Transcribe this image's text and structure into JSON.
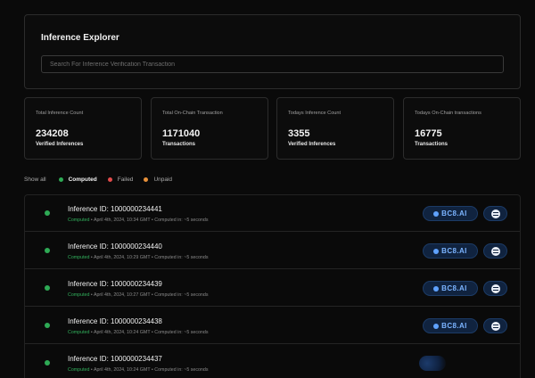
{
  "explorer": {
    "title": "Inference Explorer",
    "search_placeholder": "Search For Inference Verification Transaction"
  },
  "stats": [
    {
      "label": "Total Inference Count",
      "value": "234208",
      "sub": "Verified Inferences"
    },
    {
      "label": "Total On-Chain Transaction",
      "value": "1171040",
      "sub": "Transactions"
    },
    {
      "label": "Todays Inference Count",
      "value": "3355",
      "sub": "Verified Inferences"
    },
    {
      "label": "Todays On-Chain transactions",
      "value": "16775",
      "sub": "Transactions"
    }
  ],
  "filters": {
    "show_all": "Show all",
    "items": [
      {
        "label": "Computed",
        "color": "#2eaa55"
      },
      {
        "label": "Failed",
        "color": "#e24b4b"
      },
      {
        "label": "Unpaid",
        "color": "#e8913a"
      }
    ]
  },
  "rows": [
    {
      "title": "Inference ID: 1000000234441",
      "status": "Computed",
      "meta": " • April 4th, 2024, 10:34 GMT • Computed in: ~5 seconds",
      "chain": "BC8.AI"
    },
    {
      "title": "Inference ID: 1000000234440",
      "status": "Computed",
      "meta": " • April 4th, 2024, 10:29 GMT • Computed in: ~5 seconds",
      "chain": "BC8.AI"
    },
    {
      "title": "Inference ID: 1000000234439",
      "status": "Computed",
      "meta": " • April 4th, 2024, 10:27 GMT • Computed in: ~5 seconds",
      "chain": "BC8.AI"
    },
    {
      "title": "Inference ID: 1000000234438",
      "status": "Computed",
      "meta": " • April 4th, 2024, 10:24 GMT • Computed in: ~5 seconds",
      "chain": "BC8.AI"
    },
    {
      "title": "Inference ID: 1000000234437",
      "status": "Computed",
      "meta": " • April 4th, 2024, 10:24 GMT • Computed in: ~5 seconds",
      "chain": ""
    }
  ],
  "icons": {
    "chain": "coin-icon",
    "menu": "list-menu-icon"
  }
}
